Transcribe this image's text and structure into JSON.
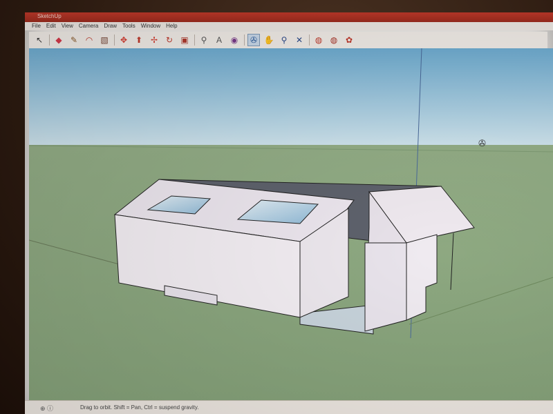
{
  "window": {
    "title": "SketchUp"
  },
  "menu": {
    "items": [
      "File",
      "Edit",
      "View",
      "Camera",
      "Draw",
      "Tools",
      "Window",
      "Help"
    ]
  },
  "toolbar": {
    "tools": [
      {
        "name": "select-icon",
        "glyph": "↖",
        "color": "#333333"
      },
      {
        "name": "eraser-icon",
        "glyph": "◆",
        "color": "#d6394a"
      },
      {
        "name": "line-icon",
        "glyph": "✎",
        "color": "#8a5a2a"
      },
      {
        "name": "arc-icon",
        "glyph": "◠",
        "color": "#c0392b"
      },
      {
        "name": "rectangle-icon",
        "glyph": "▧",
        "color": "#7a4a3a"
      },
      {
        "name": "move-icon",
        "glyph": "✥",
        "color": "#d4382c"
      },
      {
        "name": "pushpull-icon",
        "glyph": "⬆",
        "color": "#c0392b"
      },
      {
        "name": "rotate-icon",
        "glyph": "✢",
        "color": "#d4382c"
      },
      {
        "name": "followme-icon",
        "glyph": "↻",
        "color": "#c0392b"
      },
      {
        "name": "scale-icon",
        "glyph": "▣",
        "color": "#b03a2e"
      },
      {
        "name": "tape-measure-icon",
        "glyph": "⚲",
        "color": "#555555"
      },
      {
        "name": "text-icon",
        "glyph": "A",
        "color": "#555555"
      },
      {
        "name": "paint-bucket-icon",
        "glyph": "◉",
        "color": "#7a3a8a"
      },
      {
        "name": "orbit-icon",
        "glyph": "✇",
        "color": "#2a5a9a",
        "active": true
      },
      {
        "name": "pan-icon",
        "glyph": "✋",
        "color": "#4a6aa0"
      },
      {
        "name": "zoom-icon",
        "glyph": "⚲",
        "color": "#2a4a8a"
      },
      {
        "name": "zoom-extents-icon",
        "glyph": "✕",
        "color": "#2a4a8a"
      },
      {
        "name": "warehouse-icon",
        "glyph": "◍",
        "color": "#c0392b"
      },
      {
        "name": "share-model-icon",
        "glyph": "◍",
        "color": "#a93226"
      },
      {
        "name": "extension-icon",
        "glyph": "✿",
        "color": "#c0392b"
      }
    ]
  },
  "status": {
    "hint": "Drag to orbit. Shift = Pan, Ctrl = suspend gravity."
  },
  "colors": {
    "sky_top": "#7fb7d6",
    "sky_bottom": "#dbe9ef",
    "ground": "#8fab82",
    "building_face": "#f3eef3",
    "building_shade": "#e3dde6",
    "glass": "#b9d6e6"
  }
}
